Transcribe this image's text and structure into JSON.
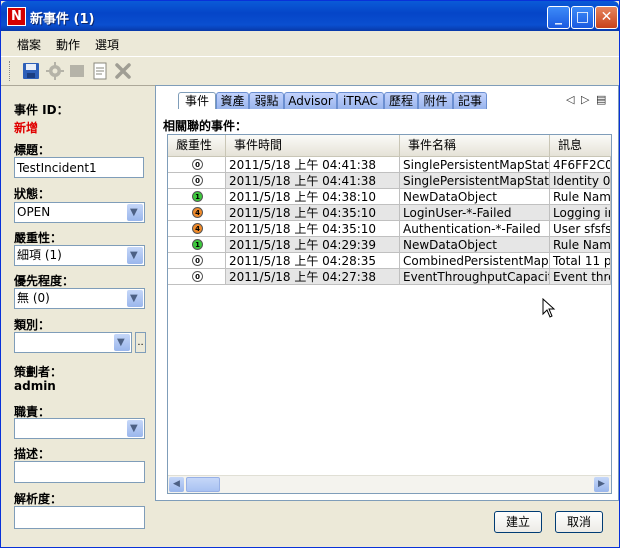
{
  "window": {
    "title": "新事件 (1)"
  },
  "titlebar": {
    "minimize_glyph": "_",
    "maximize_glyph": "□",
    "close_glyph": "✕",
    "app_icon_letter": "N"
  },
  "menu": {
    "items": [
      "檔案",
      "動作",
      "選項"
    ]
  },
  "toolbar": {
    "icons": [
      "save-icon",
      "gear-icon",
      "stop-icon",
      "export-icon",
      "delete-icon"
    ]
  },
  "form": {
    "id_label": "事件 ID：",
    "id_value": "新增",
    "title_label": "標題：",
    "title_value": "TestIncident1",
    "status_label": "狀態：",
    "status_value": "OPEN",
    "severity_label": "嚴重性：",
    "severity_value": "細項 (1)",
    "priority_label": "優先程度：",
    "priority_value": "無 (0)",
    "category_label": "類別：",
    "category_value": "",
    "planner_label": "策劃者：",
    "planner_value": "admin",
    "role_label": "職責：",
    "role_value": "",
    "description_label": "描述：",
    "description_value": "",
    "resolution_label": "解析度：",
    "resolution_value": ""
  },
  "tabs": [
    "事件",
    "資產",
    "弱點",
    "Advisor",
    "iTRAC",
    "歷程",
    "附件",
    "記事"
  ],
  "related": {
    "title": "相關聯的事件：",
    "columns": [
      "嚴重性",
      "事件時間",
      "事件名稱",
      "訊息"
    ],
    "rows": [
      {
        "severity": "0",
        "severity_color": "#ffffff",
        "time": "2011/5/18 上午 04:41:38",
        "name": "SinglePersistentMapStatus",
        "message": "4F6FF2C0"
      },
      {
        "severity": "0",
        "severity_color": "#ffffff",
        "time": "2011/5/18 上午 04:41:38",
        "name": "SinglePersistentMapStatus",
        "message": "Identity 0K"
      },
      {
        "severity": "1",
        "severity_color": "#3cc83c",
        "time": "2011/5/18 上午 04:38:10",
        "name": "NewDataObject",
        "message": "Rule Nam"
      },
      {
        "severity": "4",
        "severity_color": "#f08a2a",
        "time": "2011/5/18 上午 04:35:10",
        "name": "LoginUser-*-Failed",
        "message": "Logging in"
      },
      {
        "severity": "4",
        "severity_color": "#f08a2a",
        "time": "2011/5/18 上午 04:35:10",
        "name": "Authentication-*-Failed",
        "message": "User sfsfs"
      },
      {
        "severity": "1",
        "severity_color": "#3cc83c",
        "time": "2011/5/18 上午 04:29:39",
        "name": "NewDataObject",
        "message": "Rule Nam"
      },
      {
        "severity": "0",
        "severity_color": "#ffffff",
        "time": "2011/5/18 上午 04:28:35",
        "name": "CombinedPersistentMap...",
        "message": "Total 11 p"
      },
      {
        "severity": "0",
        "severity_color": "#ffffff",
        "time": "2011/5/18 上午 04:27:38",
        "name": "EventThroughputCapacity",
        "message": "Event thro"
      }
    ]
  },
  "buttons": {
    "create": "建立",
    "cancel": "取消"
  }
}
